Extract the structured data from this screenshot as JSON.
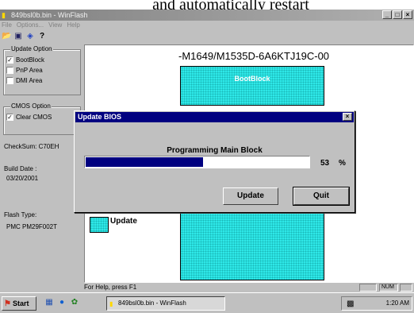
{
  "document": {
    "top_text": "and automatically restart"
  },
  "window": {
    "title": "849bsl0b.bin - WinFlash",
    "controls": [
      "_",
      "□",
      "×"
    ]
  },
  "menu": {
    "items": [
      "File",
      "Options...",
      "View",
      "Help"
    ]
  },
  "toolbar": {
    "icons": [
      "open-folder-icon",
      "save-icon",
      "flash-chip-icon",
      "help-icon"
    ]
  },
  "left_panel": {
    "update_option": {
      "label": "Update Option",
      "items": [
        {
          "label": "BootBlock",
          "checked": true
        },
        {
          "label": "PnP Area",
          "checked": false
        },
        {
          "label": "DMI Area",
          "checked": false
        }
      ]
    },
    "cmos_option": {
      "label": "CMOS Option",
      "items": [
        {
          "label": "Clear CMOS",
          "checked": true
        }
      ]
    },
    "checksum": "CheckSum:  C70EH",
    "build_date_label": "Build Date :",
    "build_date": "03/20/2001",
    "flash_type_label": "Flash Type:",
    "flash_type": "PMC PM29F002T"
  },
  "main": {
    "bios_id": "-M1649/M1535D-6A6KTJ19C-00",
    "boot_block_label": "BootBlock",
    "legend_update_label": "Update"
  },
  "dialog": {
    "title": "Update BIOS",
    "close_glyph": "×",
    "status": "Programming Main Block",
    "progress_percent": 53,
    "percent_value": "53",
    "percent_sign": "%",
    "update_button": "Update",
    "quit_button": "Quit"
  },
  "statusbar": {
    "help_text": "For Help, press F1",
    "num_indicator": "NUM"
  },
  "taskbar": {
    "start_label": "Start",
    "task_label": "849bsl0b.bin - WinFlash",
    "clock": "1:20 AM"
  },
  "colors": {
    "chip_fill": "#2ee8e8",
    "dialog_title_bg": "#000080",
    "progress_fill": "#000080"
  }
}
